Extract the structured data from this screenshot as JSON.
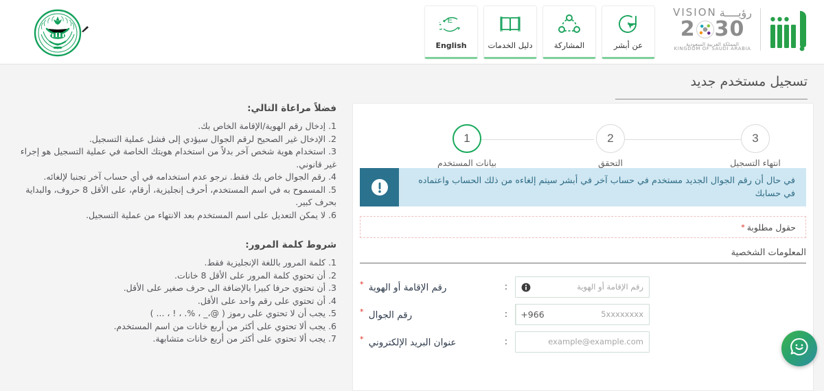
{
  "header": {
    "nav_tiles": [
      {
        "label": "عن أبشر",
        "icon": "about-cursor-icon"
      },
      {
        "label": "المشاركة",
        "icon": "share-network-icon"
      },
      {
        "label": "دليل الخدمات",
        "icon": "services-guide-book-icon"
      },
      {
        "label": "English",
        "icon": "language-switch-icon"
      }
    ],
    "moi_logo_alt": "شعار وزارة الداخلية",
    "vision": {
      "vision_en": "VISION",
      "vision_ar": "رؤيــــة",
      "year_left": "2",
      "year_right": "30",
      "kingdom_ar": "المملكة العربية السعودية",
      "kingdom_en": "KINGDOM OF SAUDI ARABIA"
    },
    "absher_logo_alt": "أبشر"
  },
  "page": {
    "title": "تسجيل مستخدم جديد"
  },
  "instructions": {
    "notice_heading": "فضلاً مراعاة التالي:",
    "notice_items": [
      "1. إدخال رقم الهوية/الإقامة الخاص بك.",
      "2. الإدخال غير الصحيح لرقم الجوال سيؤدي إلى فشل عملية التسجيل.",
      "3. استخدام هوية شخص آخر بدلاً من استخدام هويتك الخاصة في عملية التسجيل هو إجراء غير قانوني.",
      "4. رقم الجوال خاص بك فقط. نرجو عدم استخدامه في أي حساب آخر تجنبا لإلغائه.",
      "5. المسموح به في اسم المستخدم، أحرف إنجليزية، أرقام، على الأقل 8 حروف، والبداية بحرف كبير.",
      "6. لا يمكن التعديل على اسم المستخدم بعد الانتهاء من عملية التسجيل."
    ],
    "password_heading": "شروط كلمة المرور:",
    "password_items": [
      "1. كلمة المرور باللغة الإنجليزية فقط.",
      "2. أن تحتوي كلمة المرور على الأقل 8 خانات.",
      "3. أن تحتوي حرفا كبيرا بالإضافة الى حرف صغير على الأقل.",
      "4. أن تحتوي على رقم واحد على الأقل.",
      "5. يجب أن لا تحتوي على رموز ( @،_ ، %. ، ! ، ... )",
      "6. يجب ألا تحتوي على أكثر من أربع خانات من اسم المستخدم.",
      "7. يجب ألا تحتوي على أكثر من أربع خانات متشابهة."
    ]
  },
  "stepper": {
    "steps": [
      {
        "number": "1",
        "caption": "بيانات المستخدم",
        "active": true
      },
      {
        "number": "2",
        "caption": "التحقق",
        "active": false
      },
      {
        "number": "3",
        "caption": "انتهاء التسجيل",
        "active": false
      }
    ]
  },
  "alert": {
    "icon": "exclamation-circle-icon",
    "text": "في حال أن رقم الجوال الجديد مستخدم في حساب آخر في أبشر سيتم إلغاءه من ذلك الحساب واعتماده في حسابك",
    "bg_color": "#cfe7f2",
    "icon_bg_color": "#2b728e",
    "text_color": "#2f6c86"
  },
  "required_note": {
    "text": "حقول مطلوبة",
    "asterisk": "*",
    "asterisk_color": "#e02b20"
  },
  "form": {
    "section_title": "المعلومات الشخصية",
    "colon": ":",
    "fields": [
      {
        "label": "رقم الإقامة أو الهوية",
        "required": "*",
        "placeholder": "رقم الإقامة أو الهوية",
        "icon": "info-circle-icon",
        "type": "text"
      },
      {
        "label": "رقم الجوال",
        "required": "*",
        "country_code": "+966",
        "placeholder": "5xxxxxxxx",
        "type": "phone"
      },
      {
        "label": "عنوان البريد الإلكتروني",
        "required": "*",
        "placeholder": "example@example.com",
        "type": "email"
      }
    ]
  },
  "chat": {
    "icon": "chat-smile-bubble-icon",
    "accent_color": "#2aa36d"
  },
  "theme": {
    "green": "#18a95b",
    "page_bg": "#f4f4f4",
    "card_bg": "#ffffff"
  }
}
